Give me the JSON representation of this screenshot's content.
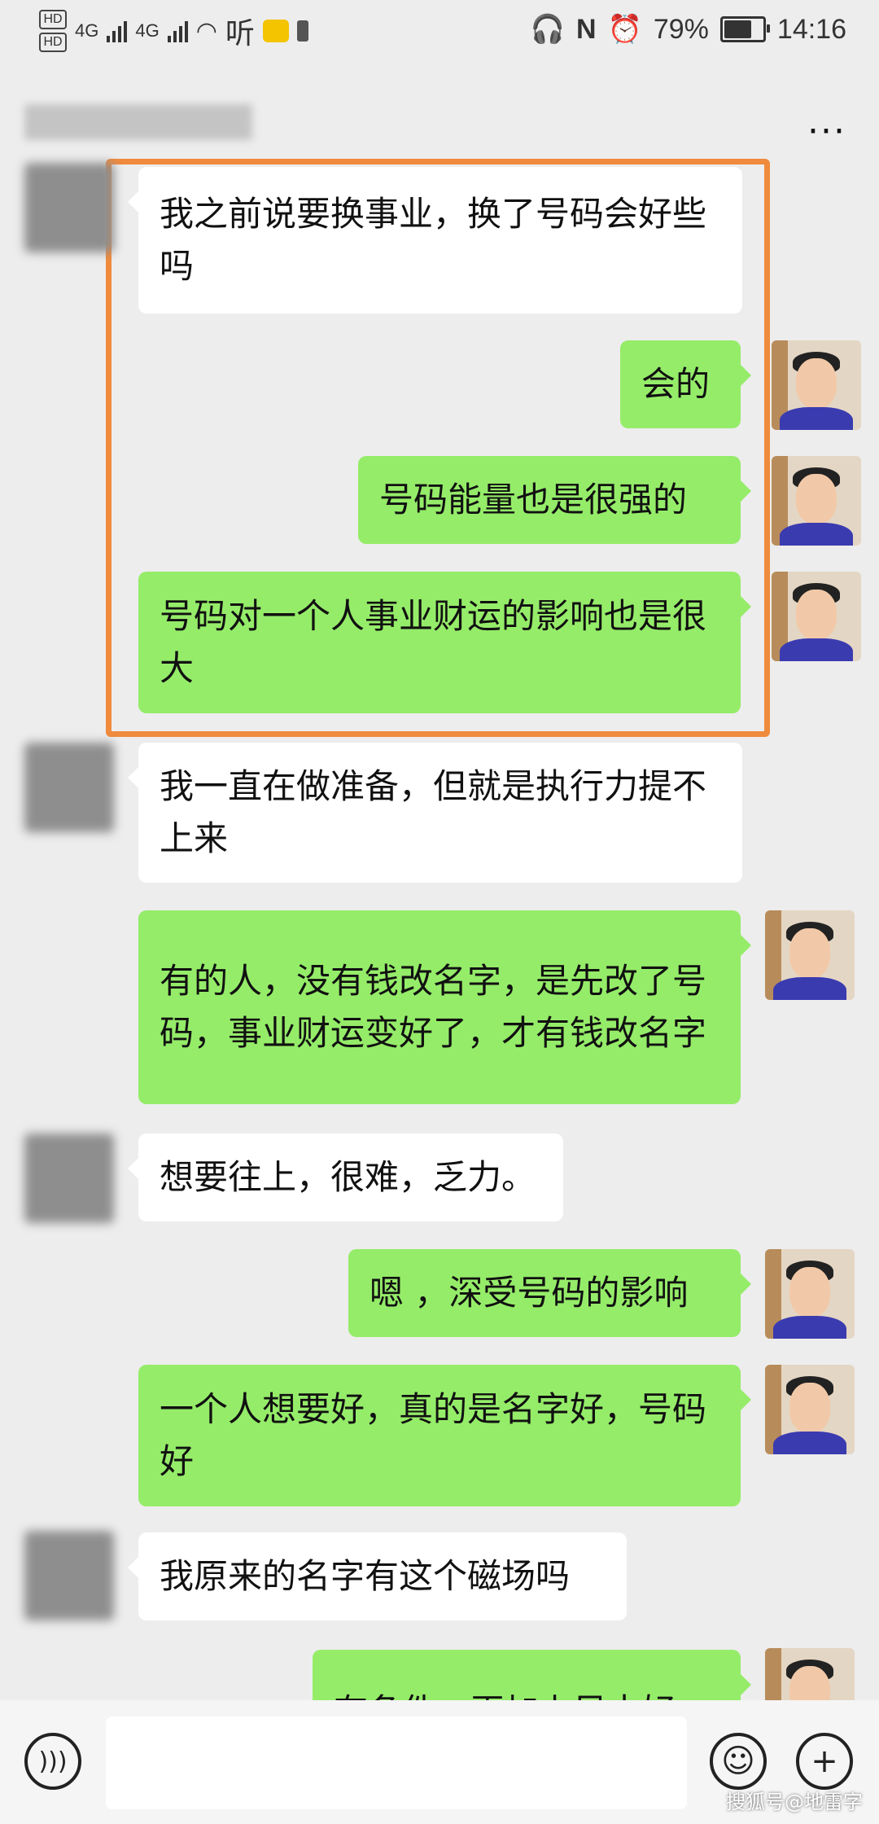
{
  "status_bar": {
    "hd1": "HD",
    "hd2": "HD",
    "net1": "4G",
    "net2": "4G",
    "listen_label": "听",
    "battery": "79%",
    "battery_level": 0.79,
    "time": "14:16"
  },
  "header": {
    "more_label": "···"
  },
  "messages": [
    {
      "side": "left",
      "text": "我之前说要换事业，换了号码会好些吗"
    },
    {
      "side": "right",
      "text": "会的"
    },
    {
      "side": "right",
      "text": "号码能量也是很强的"
    },
    {
      "side": "right",
      "text": "号码对一个人事业财运的影响也是很大"
    },
    {
      "side": "left",
      "text": "我一直在做准备，但就是执行力提不上来"
    },
    {
      "side": "right",
      "text": "有的人，没有钱改名字，是先改了号码，事业财运变好了，才有钱改名字"
    },
    {
      "side": "left",
      "text": "想要往上，很难，乏力。"
    },
    {
      "side": "right",
      "text": "嗯 ，深受号码的影响"
    },
    {
      "side": "right",
      "text": "一个人想要好，真的是名字好，号码好"
    },
    {
      "side": "left",
      "text": "我原来的名字有这个磁场吗"
    },
    {
      "side": "right",
      "text": "有条件，再加上风水好"
    }
  ],
  "input_bar": {
    "voice_icon": "voice-icon",
    "emoji_icon": "emoji-icon",
    "plus_icon": "plus-icon"
  },
  "watermark": "搜狐号@地雷字"
}
